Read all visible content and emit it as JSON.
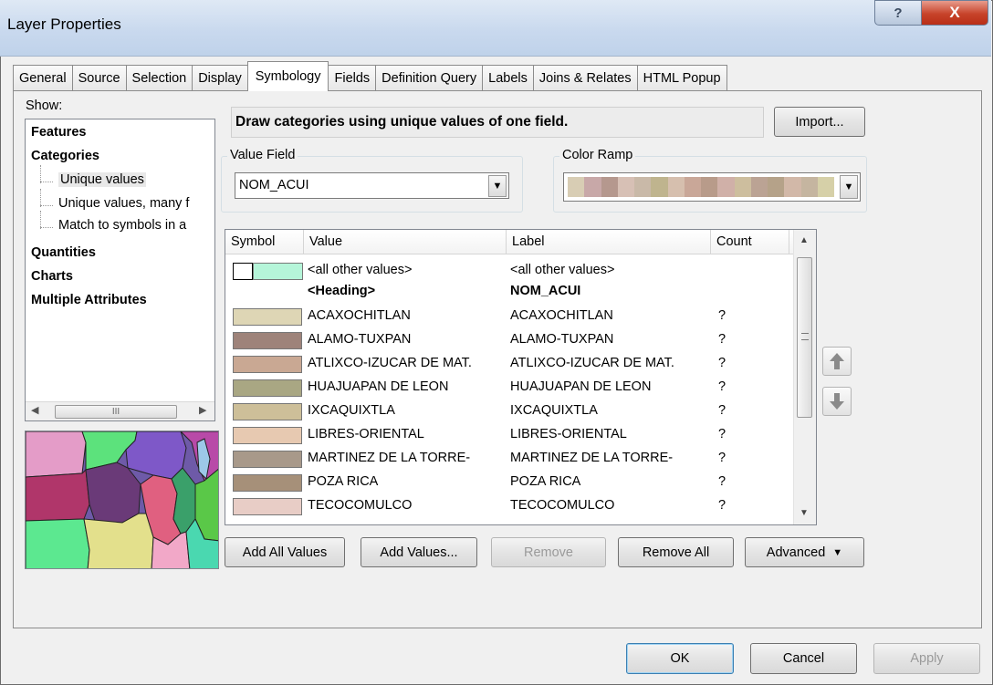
{
  "window": {
    "title": "Layer Properties",
    "help_label": "?",
    "close_label": "X"
  },
  "tabs": [
    "General",
    "Source",
    "Selection",
    "Display",
    "Symbology",
    "Fields",
    "Definition Query",
    "Labels",
    "Joins & Relates",
    "HTML Popup"
  ],
  "active_tab": "Symbology",
  "show": {
    "label": "Show:",
    "features": "Features",
    "categories": "Categories",
    "unique_values": "Unique values",
    "unique_values_many": "Unique values, many f",
    "match_symbols": "Match to symbols in a",
    "quantities": "Quantities",
    "charts": "Charts",
    "multiple_attributes": "Multiple Attributes",
    "scroll_thumb": "III"
  },
  "description": "Draw categories using unique values of one field.",
  "import_label": "Import...",
  "value_field": {
    "label": "Value Field",
    "value": "NOM_ACUI"
  },
  "color_ramp": {
    "label": "Color Ramp",
    "colors": [
      "#d8cdb4",
      "#c8a8a8",
      "#b5988e",
      "#d7c0b5",
      "#c9b9a8",
      "#bfb48e",
      "#d6bfae",
      "#c9a798",
      "#b89b8a",
      "#d0b0a8",
      "#cdbe9e",
      "#bba394",
      "#b5a289",
      "#d2b8a8",
      "#c5b5a0",
      "#d6d0a8"
    ]
  },
  "grid": {
    "columns": {
      "symbol": "Symbol",
      "value": "Value",
      "label": "Label",
      "count": "Count"
    },
    "all_other": {
      "value": "<all other values>",
      "label": "<all other values>",
      "color": "#b5f5d9"
    },
    "heading": {
      "value": "<Heading>",
      "label": "NOM_ACUI"
    },
    "rows": [
      {
        "value": "ACAXOCHITLAN",
        "label": "ACAXOCHITLAN",
        "count": "?",
        "color": "#ded6b5"
      },
      {
        "value": "ALAMO-TUXPAN",
        "label": "ALAMO-TUXPAN",
        "count": "?",
        "color": "#9e837a"
      },
      {
        "value": "ATLIXCO-IZUCAR DE MAT.",
        "label": "ATLIXCO-IZUCAR DE MAT.",
        "count": "?",
        "color": "#c9a893"
      },
      {
        "value": "HUAJUAPAN DE LEON",
        "label": "HUAJUAPAN DE LEON",
        "count": "?",
        "color": "#a9a783"
      },
      {
        "value": "IXCAQUIXTLA",
        "label": "IXCAQUIXTLA",
        "count": "?",
        "color": "#cdbf99"
      },
      {
        "value": "LIBRES-ORIENTAL",
        "label": "LIBRES-ORIENTAL",
        "count": "?",
        "color": "#e7c9b1"
      },
      {
        "value": "MARTINEZ DE LA TORRE-",
        "label": "MARTINEZ DE LA TORRE-",
        "count": "?",
        "color": "#a8998a"
      },
      {
        "value": "POZA RICA",
        "label": "POZA RICA",
        "count": "?",
        "color": "#a69079"
      },
      {
        "value": "TECOCOMULCO",
        "label": "TECOCOMULCO",
        "count": "?",
        "color": "#e8cdc6"
      }
    ]
  },
  "buttons": {
    "add_all": "Add All Values",
    "add_values": "Add Values...",
    "remove": "Remove",
    "remove_all": "Remove All",
    "advanced": "Advanced",
    "ok": "OK",
    "cancel": "Cancel",
    "apply": "Apply"
  }
}
